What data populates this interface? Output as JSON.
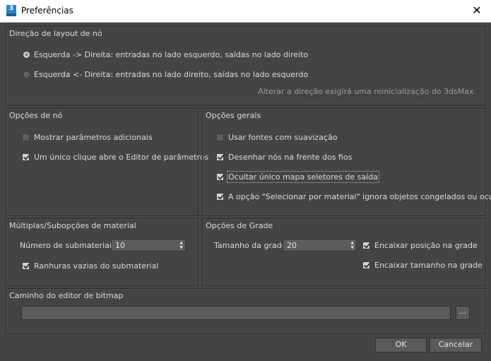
{
  "window": {
    "title": "Preferências",
    "app_icon_text": "3",
    "close_glyph": "✕"
  },
  "layout_direction": {
    "label": "Direção de layout de nó",
    "options": [
      {
        "label": "Esquerda -> Direita: entradas no lado esquerdo, saídas no lado direito",
        "selected": true
      },
      {
        "label": "Esquerda <- Direita: entradas no lado direito, saídas no lado esquerdo",
        "selected": false
      }
    ],
    "note": "Alterar a direção exigirá uma reinicialização do 3dsMax."
  },
  "node_options": {
    "label": "Opções de nó",
    "items": [
      {
        "label": "Mostrar parâmetros adicionais",
        "checked": false
      },
      {
        "label": "Um único clique abre o Editor de parâmetros",
        "checked": true
      }
    ]
  },
  "general_options": {
    "label": "Opções gerais",
    "items": [
      {
        "label": "Usar fontes com suavização",
        "checked": false
      },
      {
        "label": "Desenhar nós na frente dos fios",
        "checked": true
      },
      {
        "label": "Ocultar único mapa seletores de saída",
        "checked": true
      },
      {
        "label": "A opção \"Selecionar por material\" ignora objetos congelados ou ocultos",
        "checked": true
      }
    ]
  },
  "material_suboptions": {
    "label": "Múltiplas/Subopções de material",
    "count_label": "Número de submateriais:",
    "count_value": "10",
    "empty_slots_label": "Ranhuras vazias do submaterial",
    "empty_slots_checked": true
  },
  "grid_options": {
    "label": "Opções de Grade",
    "size_label": "Tamanho da grade:",
    "size_value": "20",
    "snap_position_label": "Encaixar posição na grade",
    "snap_position_checked": true,
    "snap_size_label": "Encaixar tamanho na grade",
    "snap_size_checked": true
  },
  "bitmap_editor": {
    "label": "Caminho do editor de bitmap",
    "path_value": "",
    "browse_label": "..."
  },
  "buttons": {
    "ok": "OK",
    "cancel": "Cancelar"
  }
}
